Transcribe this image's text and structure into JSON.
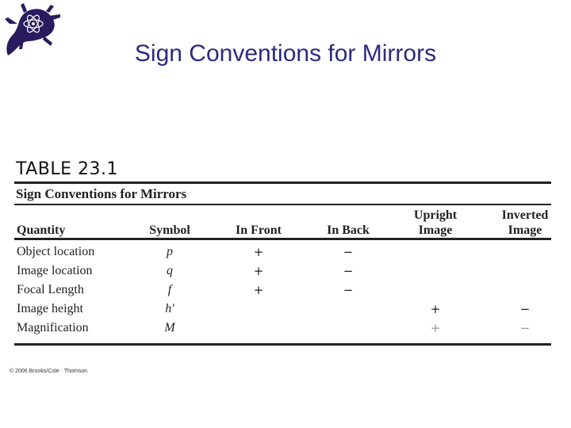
{
  "slide": {
    "title": "Sign Conventions for Mirrors",
    "logo_icon": "horned-lizard-atom-logo"
  },
  "table": {
    "label": "TABLE 23.1",
    "caption": "Sign Conventions for Mirrors",
    "headers": {
      "quantity": "Quantity",
      "symbol": "Symbol",
      "in_front": "In Front",
      "in_back": "In Back",
      "upright_1": "Upright",
      "upright_2": "Image",
      "inverted_1": "Inverted",
      "inverted_2": "Image"
    },
    "rows": [
      {
        "quantity": "Object location",
        "symbol": "p",
        "in_front": "+",
        "in_back": "−",
        "upright": "",
        "inverted": ""
      },
      {
        "quantity": "Image location",
        "symbol": "q",
        "in_front": "+",
        "in_back": "−",
        "upright": "",
        "inverted": ""
      },
      {
        "quantity": "Focal Length",
        "symbol": "f",
        "in_front": "+",
        "in_back": "−",
        "upright": "",
        "inverted": ""
      },
      {
        "quantity": "Image height",
        "symbol": "h′",
        "in_front": "",
        "in_back": "",
        "upright": "+",
        "inverted": "−"
      },
      {
        "quantity": "Magnification",
        "symbol": "M",
        "in_front": "",
        "in_back": "",
        "upright": "+",
        "inverted": "−"
      }
    ]
  },
  "footer": {
    "copyright": "© 2006 Brooks/Cole · Thomson"
  }
}
